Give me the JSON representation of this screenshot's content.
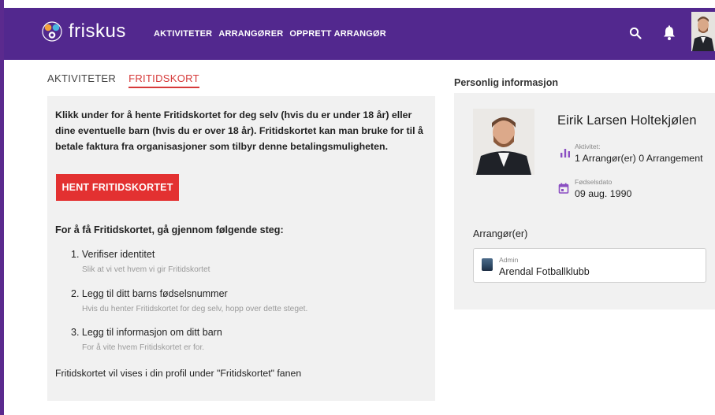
{
  "header": {
    "brand": "friskus",
    "nav": [
      "AKTIVITETER",
      "ARRANGØRER",
      "OPPRETT ARRANGØR"
    ],
    "icons": {
      "search": "search-icon",
      "bell": "bell-icon",
      "avatar": "avatar"
    },
    "colors": {
      "bar": "#52288e",
      "accent": "#e33131"
    }
  },
  "tabs": [
    {
      "label": "AKTIVITETER",
      "active": false
    },
    {
      "label": "FRITIDSKORT",
      "active": true
    }
  ],
  "fritidskort": {
    "intro": "Klikk under for å hente Fritidskortet for deg selv (hvis du er under 18 år) eller dine eventuelle barn (hvis du er over 18 år). Fritidskortet kan man bruke for til å betale faktura fra organisasjoner som tilbyr denne betalingsmuligheten.",
    "button_label": "HENT FRITIDSKORTET",
    "steps_title": "For å få Fritidskortet, gå gjennom følgende steg:",
    "steps": [
      {
        "title": "1. Verifiser identitet",
        "desc": "Slik at vi vet hvem vi gir Fritidskortet"
      },
      {
        "title": "2. Legg til ditt barns fødselsnummer",
        "desc": "Hvis du henter Fritidskortet for deg selv, hopp over dette steget."
      },
      {
        "title": "3. Legg til informasjon om ditt barn",
        "desc": "For å vite hvem Fritidskortet er for."
      }
    ],
    "footer_note": "Fritidskortet vil vises i din profil under \"Fritidskortet\" fanen"
  },
  "profile": {
    "section_title": "Personlig informasjon",
    "name": "Eirik Larsen Holtekjølen",
    "activity_label": "Aktivitet:",
    "activity_value": "1 Arrangør(er) 0 Arrangement",
    "birth_label": "Fødselsdato",
    "birth_value": "09 aug. 1990",
    "organizers_title": "Arrangør(er)",
    "organizers": [
      {
        "role": "Admin",
        "name": "Arendal Fotballklubb"
      }
    ]
  }
}
